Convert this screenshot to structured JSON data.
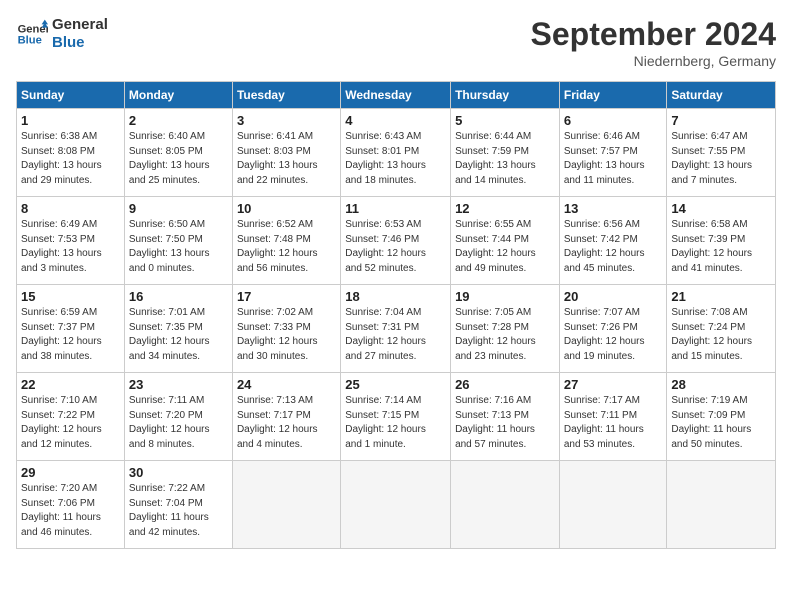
{
  "logo": {
    "line1": "General",
    "line2": "Blue"
  },
  "title": "September 2024",
  "subtitle": "Niedernberg, Germany",
  "days_of_week": [
    "Sunday",
    "Monday",
    "Tuesday",
    "Wednesday",
    "Thursday",
    "Friday",
    "Saturday"
  ],
  "weeks": [
    [
      {
        "day": 1,
        "info": "Sunrise: 6:38 AM\nSunset: 8:08 PM\nDaylight: 13 hours\nand 29 minutes."
      },
      {
        "day": 2,
        "info": "Sunrise: 6:40 AM\nSunset: 8:05 PM\nDaylight: 13 hours\nand 25 minutes."
      },
      {
        "day": 3,
        "info": "Sunrise: 6:41 AM\nSunset: 8:03 PM\nDaylight: 13 hours\nand 22 minutes."
      },
      {
        "day": 4,
        "info": "Sunrise: 6:43 AM\nSunset: 8:01 PM\nDaylight: 13 hours\nand 18 minutes."
      },
      {
        "day": 5,
        "info": "Sunrise: 6:44 AM\nSunset: 7:59 PM\nDaylight: 13 hours\nand 14 minutes."
      },
      {
        "day": 6,
        "info": "Sunrise: 6:46 AM\nSunset: 7:57 PM\nDaylight: 13 hours\nand 11 minutes."
      },
      {
        "day": 7,
        "info": "Sunrise: 6:47 AM\nSunset: 7:55 PM\nDaylight: 13 hours\nand 7 minutes."
      }
    ],
    [
      {
        "day": 8,
        "info": "Sunrise: 6:49 AM\nSunset: 7:53 PM\nDaylight: 13 hours\nand 3 minutes."
      },
      {
        "day": 9,
        "info": "Sunrise: 6:50 AM\nSunset: 7:50 PM\nDaylight: 13 hours\nand 0 minutes."
      },
      {
        "day": 10,
        "info": "Sunrise: 6:52 AM\nSunset: 7:48 PM\nDaylight: 12 hours\nand 56 minutes."
      },
      {
        "day": 11,
        "info": "Sunrise: 6:53 AM\nSunset: 7:46 PM\nDaylight: 12 hours\nand 52 minutes."
      },
      {
        "day": 12,
        "info": "Sunrise: 6:55 AM\nSunset: 7:44 PM\nDaylight: 12 hours\nand 49 minutes."
      },
      {
        "day": 13,
        "info": "Sunrise: 6:56 AM\nSunset: 7:42 PM\nDaylight: 12 hours\nand 45 minutes."
      },
      {
        "day": 14,
        "info": "Sunrise: 6:58 AM\nSunset: 7:39 PM\nDaylight: 12 hours\nand 41 minutes."
      }
    ],
    [
      {
        "day": 15,
        "info": "Sunrise: 6:59 AM\nSunset: 7:37 PM\nDaylight: 12 hours\nand 38 minutes."
      },
      {
        "day": 16,
        "info": "Sunrise: 7:01 AM\nSunset: 7:35 PM\nDaylight: 12 hours\nand 34 minutes."
      },
      {
        "day": 17,
        "info": "Sunrise: 7:02 AM\nSunset: 7:33 PM\nDaylight: 12 hours\nand 30 minutes."
      },
      {
        "day": 18,
        "info": "Sunrise: 7:04 AM\nSunset: 7:31 PM\nDaylight: 12 hours\nand 27 minutes."
      },
      {
        "day": 19,
        "info": "Sunrise: 7:05 AM\nSunset: 7:28 PM\nDaylight: 12 hours\nand 23 minutes."
      },
      {
        "day": 20,
        "info": "Sunrise: 7:07 AM\nSunset: 7:26 PM\nDaylight: 12 hours\nand 19 minutes."
      },
      {
        "day": 21,
        "info": "Sunrise: 7:08 AM\nSunset: 7:24 PM\nDaylight: 12 hours\nand 15 minutes."
      }
    ],
    [
      {
        "day": 22,
        "info": "Sunrise: 7:10 AM\nSunset: 7:22 PM\nDaylight: 12 hours\nand 12 minutes."
      },
      {
        "day": 23,
        "info": "Sunrise: 7:11 AM\nSunset: 7:20 PM\nDaylight: 12 hours\nand 8 minutes."
      },
      {
        "day": 24,
        "info": "Sunrise: 7:13 AM\nSunset: 7:17 PM\nDaylight: 12 hours\nand 4 minutes."
      },
      {
        "day": 25,
        "info": "Sunrise: 7:14 AM\nSunset: 7:15 PM\nDaylight: 12 hours\nand 1 minute."
      },
      {
        "day": 26,
        "info": "Sunrise: 7:16 AM\nSunset: 7:13 PM\nDaylight: 11 hours\nand 57 minutes."
      },
      {
        "day": 27,
        "info": "Sunrise: 7:17 AM\nSunset: 7:11 PM\nDaylight: 11 hours\nand 53 minutes."
      },
      {
        "day": 28,
        "info": "Sunrise: 7:19 AM\nSunset: 7:09 PM\nDaylight: 11 hours\nand 50 minutes."
      }
    ],
    [
      {
        "day": 29,
        "info": "Sunrise: 7:20 AM\nSunset: 7:06 PM\nDaylight: 11 hours\nand 46 minutes."
      },
      {
        "day": 30,
        "info": "Sunrise: 7:22 AM\nSunset: 7:04 PM\nDaylight: 11 hours\nand 42 minutes."
      },
      null,
      null,
      null,
      null,
      null
    ]
  ]
}
